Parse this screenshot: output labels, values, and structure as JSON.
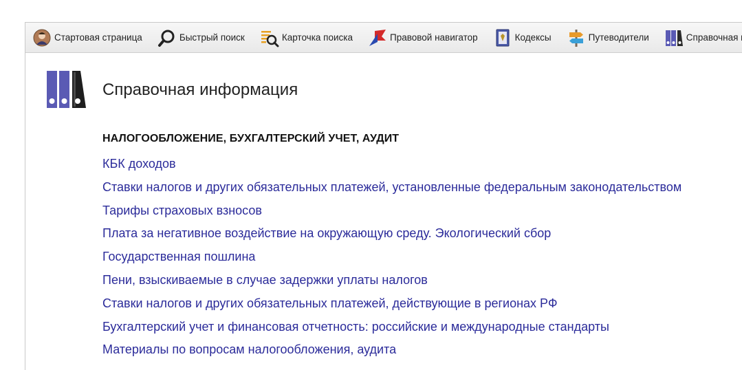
{
  "toolbar": {
    "items": [
      {
        "label": "Стартовая страница",
        "icon": "start-page-avatar-icon"
      },
      {
        "label": "Быстрый поиск",
        "icon": "magnifier-icon"
      },
      {
        "label": "Карточка поиска",
        "icon": "search-card-icon"
      },
      {
        "label": "Правовой навигатор",
        "icon": "navigator-flag-icon"
      },
      {
        "label": "Кодексы",
        "icon": "codex-book-icon"
      },
      {
        "label": "Путеводители",
        "icon": "signpost-icon"
      },
      {
        "label": "Справочная информация",
        "icon": "binders-icon"
      }
    ]
  },
  "main": {
    "icon": "binders-icon",
    "title": "Справочная информация",
    "section_heading": "НАЛОГООБЛОЖЕНИЕ, БУХГАЛТЕРСКИЙ УЧЕТ, АУДИТ",
    "links": [
      "КБК доходов",
      "Ставки налогов и других обязательных платежей, установленные федеральным законодательством",
      "Тарифы страховых взносов",
      "Плата за негативное воздействие на окружающую среду. Экологический сбор",
      "Государственная пошлина",
      "Пени, взыскиваемые в случае задержки уплаты налогов",
      "Ставки налогов и других обязательных платежей, действующие в регионах РФ",
      "Бухгалтерский учет и финансовая отчетность: российские и международные стандарты",
      "Материалы по вопросам налогообложения, аудита"
    ]
  },
  "colors": {
    "link": "#2b2b9a",
    "binder_purple": "#5a5ab4",
    "toolbar_bg": "#efefef"
  }
}
